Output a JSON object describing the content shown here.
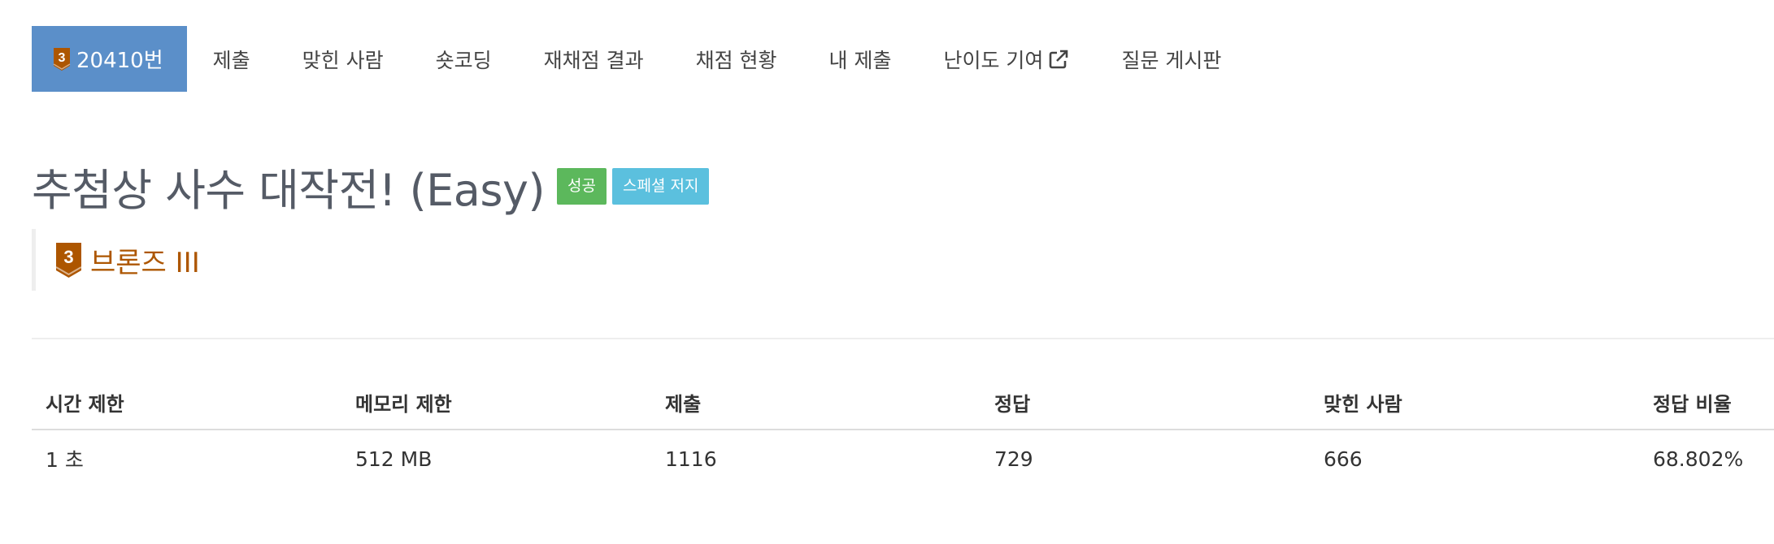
{
  "nav": {
    "tabs": [
      {
        "label": "20410번",
        "active": true,
        "tier_icon": "bronze-3-tier-icon"
      },
      {
        "label": "제출"
      },
      {
        "label": "맞힌 사람"
      },
      {
        "label": "숏코딩"
      },
      {
        "label": "재채점 결과"
      },
      {
        "label": "채점 현황"
      },
      {
        "label": "내 제출"
      },
      {
        "label": "난이도 기여",
        "icon": "external-link-icon"
      },
      {
        "label": "질문 게시판"
      }
    ]
  },
  "problem": {
    "title": "추첨상 사수 대작전! (Easy)",
    "labels": {
      "success": "성공",
      "special_judge": "스페셜 저지"
    },
    "tier": {
      "icon_text": "3",
      "name": "브론즈 III"
    }
  },
  "info_table": {
    "headers": [
      "시간 제한",
      "메모리 제한",
      "제출",
      "정답",
      "맞힌 사람",
      "정답 비율"
    ],
    "row": [
      "1 초",
      "512 MB",
      "1116",
      "729",
      "666",
      "68.802%"
    ]
  },
  "colors": {
    "active_tab": "#5b8fc9",
    "success_label": "#5cb85c",
    "info_label": "#5bc0de",
    "bronze": "#ad5600"
  }
}
